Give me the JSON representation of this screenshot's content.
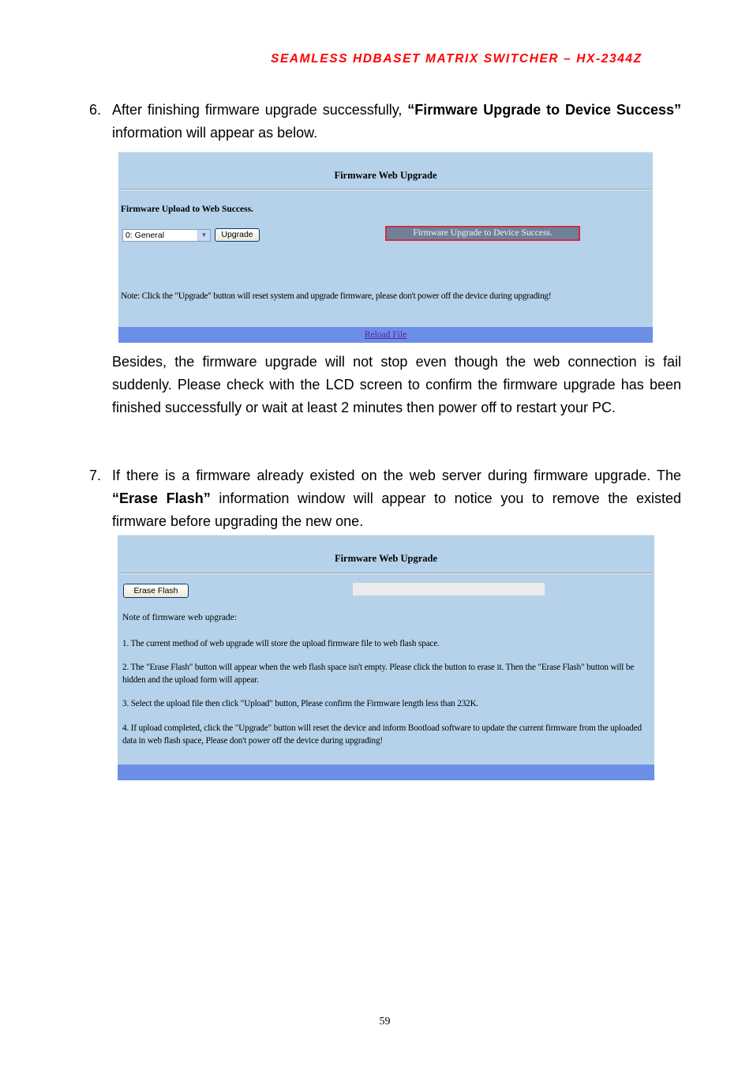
{
  "header": {
    "title": "SEAMLESS  HDBASET  MATRIX  SWITCHER  –  HX-2344Z"
  },
  "step6": {
    "number": "6.",
    "text_before": "After finishing firmware upgrade successfully, ",
    "bold": "“Firmware Upgrade to Device Success”",
    "text_after": " information will appear as below."
  },
  "screenshot1": {
    "title": "Firmware Web Upgrade",
    "upload_status": "Firmware Upload to Web Success.",
    "select": {
      "value": "0: General",
      "arrow_icon": "chevron-down-icon"
    },
    "upgrade_button": "Upgrade",
    "success_message": "Firmware Upgrade to Device Success.",
    "note": "Note: Click the \"Upgrade\" button will reset system and upgrade firmware, please don't power off the device during upgrading!",
    "reload_link": "Reload File",
    "colors": {
      "panel": "#b6d2ea",
      "footer": "#6b8fe6",
      "status_border": "#d42c3a"
    }
  },
  "besides": {
    "text": "Besides, the firmware upgrade will not stop even though the web connection is fail suddenly. Please check with the LCD screen to confirm the firmware upgrade has been finished successfully or wait at least 2 minutes then power off to restart your PC."
  },
  "step7": {
    "number": "7.",
    "text_before": "If there is a firmware already existed on the web server during firmware upgrade. The ",
    "bold": "“Erase Flash”",
    "text_after": " information window will appear to notice you to remove the existed firmware before upgrading the new one."
  },
  "screenshot2": {
    "title": "Firmware Web Upgrade",
    "erase_button": "Erase Flash",
    "progress": 0,
    "note_heading": "Note of firmware web upgrade:",
    "notes": [
      "1. The current method of web upgrade will store the upload firmware file to web flash space.",
      "2. The \"Erase Flash\" button will appear when the web flash space isn't empty. Please click the button to erase it. Then the \"Erase Flash\" button will be hidden and the upload form will appear.",
      "3. Select the upload file then click \"Upload\" button, Please confirm the Firmware length less than 232K.",
      "4. If upload completed, click the \"Upgrade\" button will reset the device and inform Bootload software to update the current firmware from the uploaded data in web flash space, Please don't power off the device during upgrading!"
    ]
  },
  "page_number": "59"
}
